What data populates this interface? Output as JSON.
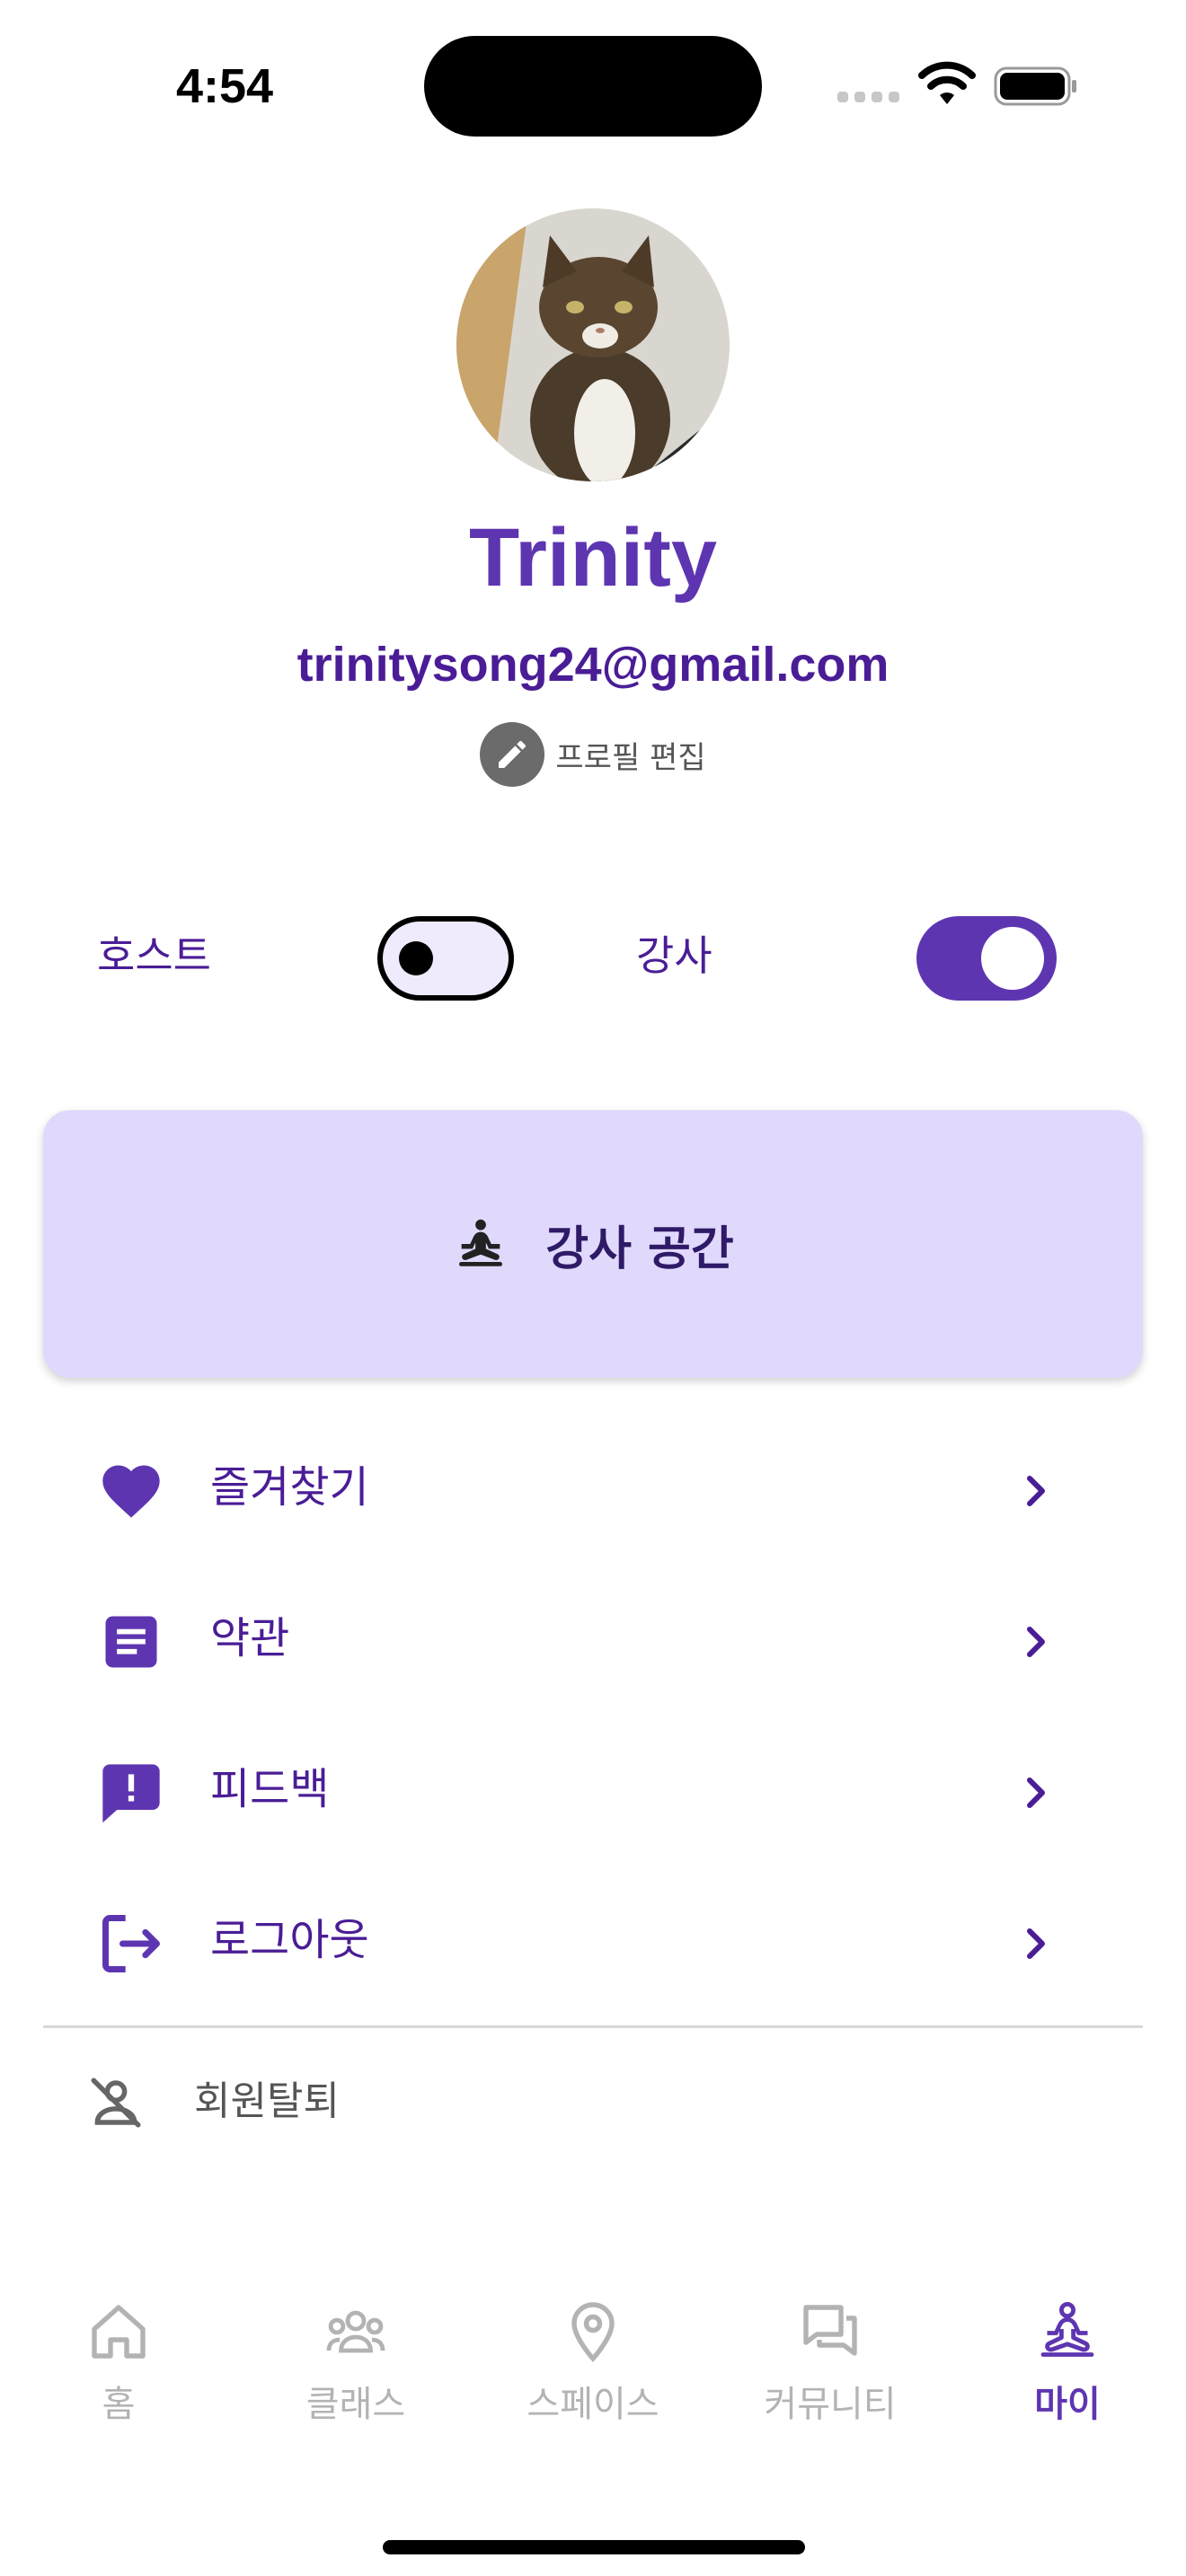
{
  "status_bar": {
    "time": "4:54"
  },
  "profile": {
    "name": "Trinity",
    "email": "trinitysong24@gmail.com",
    "edit_label": "프로필 편집"
  },
  "roles": {
    "host_label": "호스트",
    "host_enabled": false,
    "instructor_label": "강사",
    "instructor_enabled": true
  },
  "instructor_space": {
    "label": "강사 공간",
    "icon": "meditation-icon"
  },
  "menu": {
    "items": [
      {
        "label": "즐겨찾기",
        "icon": "heart-icon"
      },
      {
        "label": "약관",
        "icon": "document-icon"
      },
      {
        "label": "피드백",
        "icon": "feedback-icon"
      },
      {
        "label": "로그아웃",
        "icon": "logout-icon"
      }
    ]
  },
  "withdraw": {
    "label": "회원탈퇴",
    "icon": "person-off-icon"
  },
  "tabs": [
    {
      "label": "홈",
      "icon": "home-icon",
      "active": false
    },
    {
      "label": "클래스",
      "icon": "group-icon",
      "active": false
    },
    {
      "label": "스페이스",
      "icon": "location-pin-icon",
      "active": false
    },
    {
      "label": "커뮤니티",
      "icon": "chat-icon",
      "active": false
    },
    {
      "label": "마이",
      "icon": "meditation-icon",
      "active": true
    }
  ],
  "colors": {
    "primary": "#5e35b1",
    "primary_dark": "#4a1d96",
    "card_bg": "#e1d9fc",
    "inactive": "#b3b3b3"
  }
}
